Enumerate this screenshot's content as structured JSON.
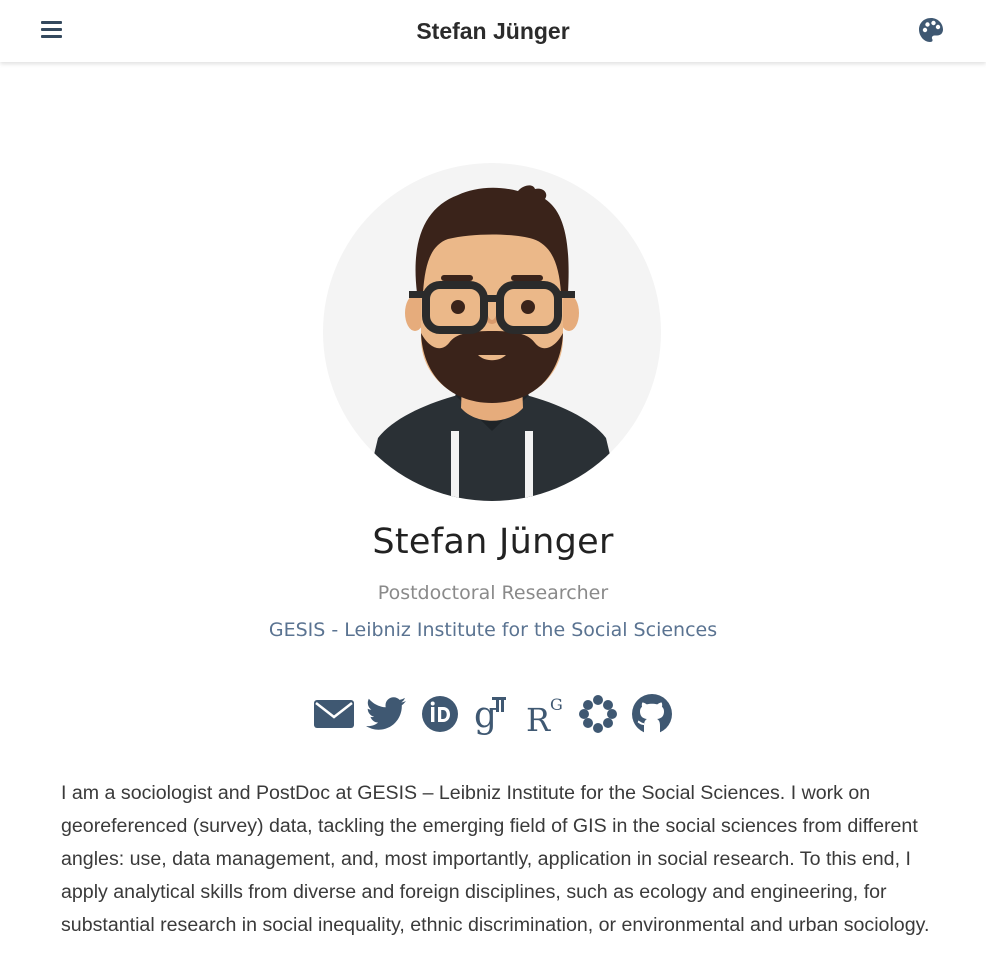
{
  "navbar": {
    "title": "Stefan Jünger",
    "menu_icon": "hamburger-menu-icon",
    "theme_icon": "palette-icon"
  },
  "profile": {
    "name": "Stefan Jünger",
    "role": "Postdoctoral Researcher",
    "organization": "GESIS - Leibniz Institute for the Social Sciences",
    "avatar": "cartoon-avatar"
  },
  "social": [
    {
      "icon": "envelope-icon",
      "label": "Email"
    },
    {
      "icon": "twitter-icon",
      "label": "Twitter"
    },
    {
      "icon": "orcid-icon",
      "label": "ORCID"
    },
    {
      "icon": "google-scholar-icon",
      "label": "Google Scholar"
    },
    {
      "icon": "researchgate-icon",
      "label": "ResearchGate"
    },
    {
      "icon": "osf-icon",
      "label": "OSF"
    },
    {
      "icon": "github-icon",
      "label": "GitHub"
    }
  ],
  "bio": "I am a sociologist and PostDoc at GESIS – Leibniz Institute for the Social Sciences. I work on georeferenced (survey) data, tackling the emerging field of GIS in the social sciences from different angles: use, data management, and, most importantly, application in social research. To this end, I apply analytical skills from diverse and foreign disciplines, such as ecology and engineering, for substantial research in social inequality, ethnic discrimination, or environmental and urban sociology.",
  "colors": {
    "icon": "#3f5872",
    "accent": "#5a7391",
    "text": "#3a3a3a",
    "avatar_bg": "#f4f4f4"
  }
}
